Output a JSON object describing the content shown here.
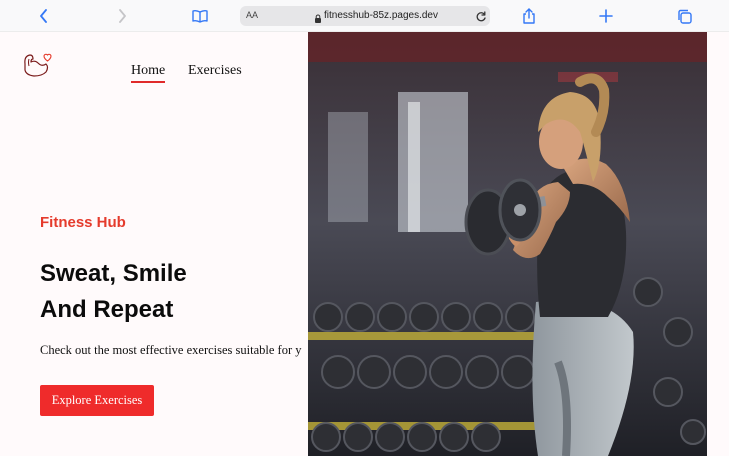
{
  "browser": {
    "url": "fitnesshub-85z.pages.dev",
    "text_size_label": "AA",
    "icons": [
      "back-icon",
      "forward-icon",
      "bookmarks-icon",
      "lock-icon",
      "reload-icon",
      "share-icon",
      "new-tab-icon",
      "tabs-icon"
    ]
  },
  "nav": {
    "home": "Home",
    "exercises": "Exercises"
  },
  "hero": {
    "brand": "Fitness Hub",
    "headline_line1": "Sweat, Smile",
    "headline_line2": "And Repeat",
    "description": "Check out the most effective exercises suitable for y",
    "cta": "Explore Exercises",
    "image_subject": "woman-curling-dumbbell-in-gym"
  },
  "colors": {
    "accent": "#ef2b2b",
    "brand_text": "#e53b2c",
    "browser_icon_blue": "#3478f6",
    "page_bg": "#fffafb"
  }
}
